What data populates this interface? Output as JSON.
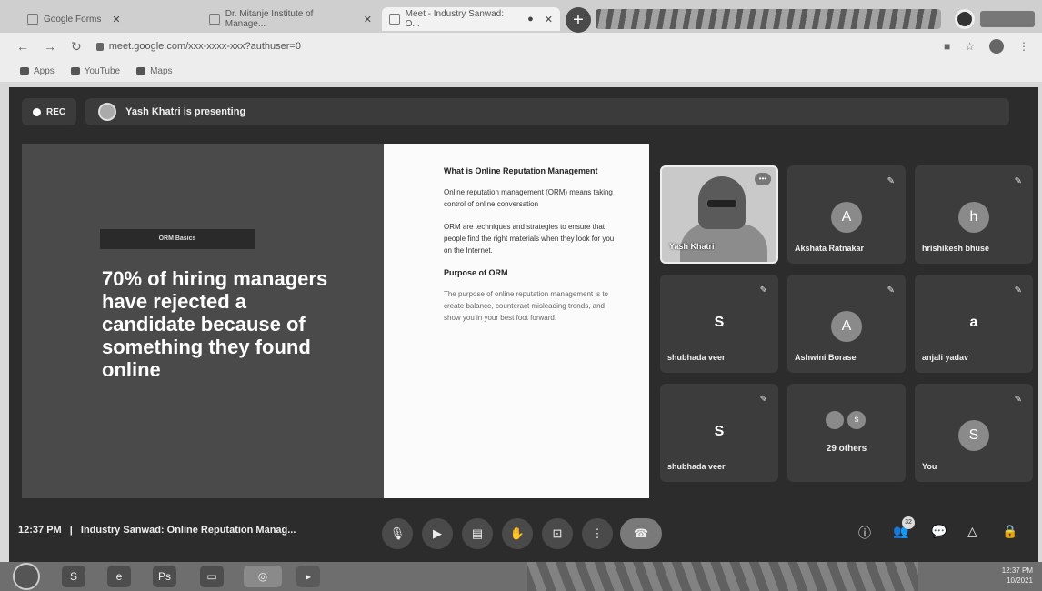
{
  "browser": {
    "tabs": [
      {
        "title": "Google Forms"
      },
      {
        "title": "Dr. Mitanje Institute of Manage..."
      },
      {
        "title": "Meet - Industry Sanwad: O..."
      }
    ],
    "url": "meet.google.com/xxx-xxxx-xxx?authuser=0",
    "bookmarks": [
      "Apps",
      "YouTube",
      "Maps"
    ]
  },
  "meet": {
    "rec_label": "REC",
    "presenter_text": "Yash Khatri is presenting",
    "slide": {
      "tag": "ORM Basics",
      "headline": "70% of hiring managers have rejected a candidate because of something they found online",
      "heading1": "What is Online Reputation Management",
      "para1": "Online reputation management (ORM) means taking control of online conversation",
      "para2": "ORM are techniques and strategies to ensure that people find the right materials when they look for you on the Internet.",
      "heading2": "Purpose of ORM",
      "para3": "The purpose of online reputation management is to create balance, counteract misleading trends, and show you in your best foot forward."
    },
    "participants": [
      {
        "name": "Yash Khatri",
        "initial": "",
        "video": true
      },
      {
        "name": "Akshata Ratnakar",
        "initial": "A"
      },
      {
        "name": "hrishikesh bhuse",
        "initial": "h"
      },
      {
        "name": "shubhada veer",
        "initial": "S"
      },
      {
        "name": "Ashwini Borase",
        "initial": "A"
      },
      {
        "name": "anjali yadav",
        "initial": "a"
      },
      {
        "name": "shubhada veer",
        "initial": "S"
      },
      {
        "name": "29 others",
        "initial": "s"
      },
      {
        "name": "You",
        "initial": "S"
      }
    ],
    "time": "12:37 PM",
    "separator": "|",
    "meeting_title": "Industry Sanwad: Online Reputation Manag...",
    "people_count": "32"
  },
  "taskbar": {
    "clock": "12:37 PM",
    "date": "10/2021"
  },
  "colors": {
    "meet_bg": "#2c2c2c",
    "tile_bg": "#3c3c3c",
    "end_call": "#7a7a7a"
  }
}
